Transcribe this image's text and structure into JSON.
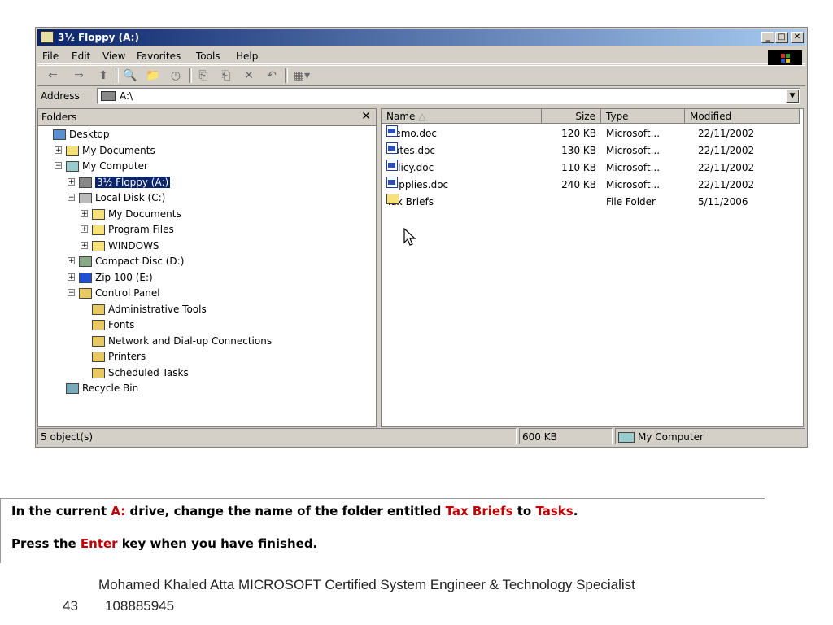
{
  "window": {
    "title": "3½ Floppy (A:)",
    "controls": {
      "minimize": "_",
      "maximize": "□",
      "close": "✕"
    }
  },
  "menu": [
    "File",
    "Edit",
    "View",
    "Favorites",
    "Tools",
    "Help"
  ],
  "toolbar": {
    "back": "⇐",
    "forward": "⇒",
    "up": "⬆",
    "search": "🔍",
    "folders": "📁",
    "history": "◷",
    "move": "⎘",
    "copy": "⎗",
    "delete": "✕",
    "undo": "↶",
    "views": "▦▾"
  },
  "address": {
    "label": "Address",
    "value": "A:\\"
  },
  "folders_pane": {
    "header": "Folders",
    "close": "✕",
    "items": [
      {
        "label": "Desktop",
        "indent": 0,
        "expander": ""
      },
      {
        "label": "My Documents",
        "indent": 1,
        "expander": "+"
      },
      {
        "label": "My Computer",
        "indent": 1,
        "expander": "−"
      },
      {
        "label": "3½ Floppy (A:)",
        "indent": 2,
        "expander": "+",
        "selected": true
      },
      {
        "label": "Local Disk (C:)",
        "indent": 2,
        "expander": "−"
      },
      {
        "label": "My Documents",
        "indent": 3,
        "expander": "+"
      },
      {
        "label": "Program Files",
        "indent": 3,
        "expander": "+"
      },
      {
        "label": "WINDOWS",
        "indent": 3,
        "expander": "+"
      },
      {
        "label": "Compact Disc (D:)",
        "indent": 2,
        "expander": "+"
      },
      {
        "label": "Zip 100  (E:)",
        "indent": 2,
        "expander": "+"
      },
      {
        "label": "Control Panel",
        "indent": 2,
        "expander": "−"
      },
      {
        "label": "Administrative Tools",
        "indent": 3,
        "expander": ""
      },
      {
        "label": "Fonts",
        "indent": 3,
        "expander": ""
      },
      {
        "label": "Network and Dial-up Connections",
        "indent": 3,
        "expander": ""
      },
      {
        "label": "Printers",
        "indent": 3,
        "expander": ""
      },
      {
        "label": "Scheduled Tasks",
        "indent": 3,
        "expander": ""
      },
      {
        "label": "Recycle Bin",
        "indent": 1,
        "expander": ""
      }
    ]
  },
  "file_list": {
    "columns": [
      "Name",
      "Size",
      "Type",
      "Modified"
    ],
    "rows": [
      {
        "name": "Memo.doc",
        "size": "120 KB",
        "type": "Microsoft...",
        "modified": "22/11/2002",
        "icon": "word-doc-icon"
      },
      {
        "name": "Notes.doc",
        "size": "130 KB",
        "type": "Microsoft...",
        "modified": "22/11/2002",
        "icon": "word-doc-icon"
      },
      {
        "name": "Policy.doc",
        "size": "110 KB",
        "type": "Microsoft...",
        "modified": "22/11/2002",
        "icon": "word-doc-icon"
      },
      {
        "name": "Supplies.doc",
        "size": "240 KB",
        "type": "Microsoft...",
        "modified": "22/11/2002",
        "icon": "word-doc-icon"
      },
      {
        "name": "Tax Briefs",
        "size": "",
        "type": "File Folder",
        "modified": "5/11/2006",
        "icon": "folder-icon"
      }
    ]
  },
  "status": {
    "objects": "5 object(s)",
    "size": "600 KB",
    "location": "My Computer"
  },
  "instruction": {
    "l1_a": "In the current ",
    "l1_drive": "A:",
    "l1_b": " drive, change the name of the folder entitled ",
    "l1_old": "Tax Briefs",
    "l1_c": " to ",
    "l1_new": "Tasks",
    "l1_d": ".",
    "l2_a": "Press the ",
    "l2_key": "Enter",
    "l2_b": " key when you have finished."
  },
  "footer": {
    "credit": "Mohamed Khaled Atta MICROSOFT Certified System Engineer & Technology Specialist",
    "page": "43",
    "phone": "108885945"
  },
  "colors": {
    "titlebar": "#0a246a",
    "highlight": "#c00000",
    "selection": "#0a246a"
  }
}
